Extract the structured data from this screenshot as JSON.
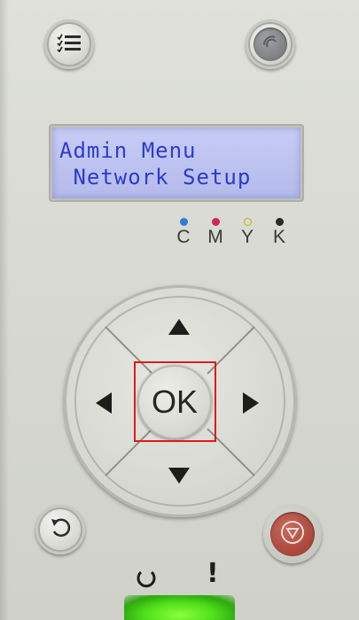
{
  "lcd": {
    "line1": "Admin Menu",
    "line2": " Network Setup",
    "text_color": "#2f3ad0",
    "backlight_color": "#c1c7f2"
  },
  "ink": [
    {
      "label": "C",
      "color": "#2a7fd6"
    },
    {
      "label": "M",
      "color": "#d0265a"
    },
    {
      "label": "Y",
      "color": "#e6d21e"
    },
    {
      "label": "K",
      "color": "#2a2a2a"
    }
  ],
  "buttons": {
    "ok_label": "OK",
    "menu_icon": "menu-list-icon",
    "wifi_icon": "wifi-icon",
    "back_icon": "back-arrow-icon",
    "stop_icon": "stop-icon"
  },
  "status": {
    "ready_icon": "ready-icon",
    "error_icon": "error-icon",
    "error_symbol": "!",
    "led_color": "#4fde1b"
  },
  "highlight_color": "#e01a1a"
}
